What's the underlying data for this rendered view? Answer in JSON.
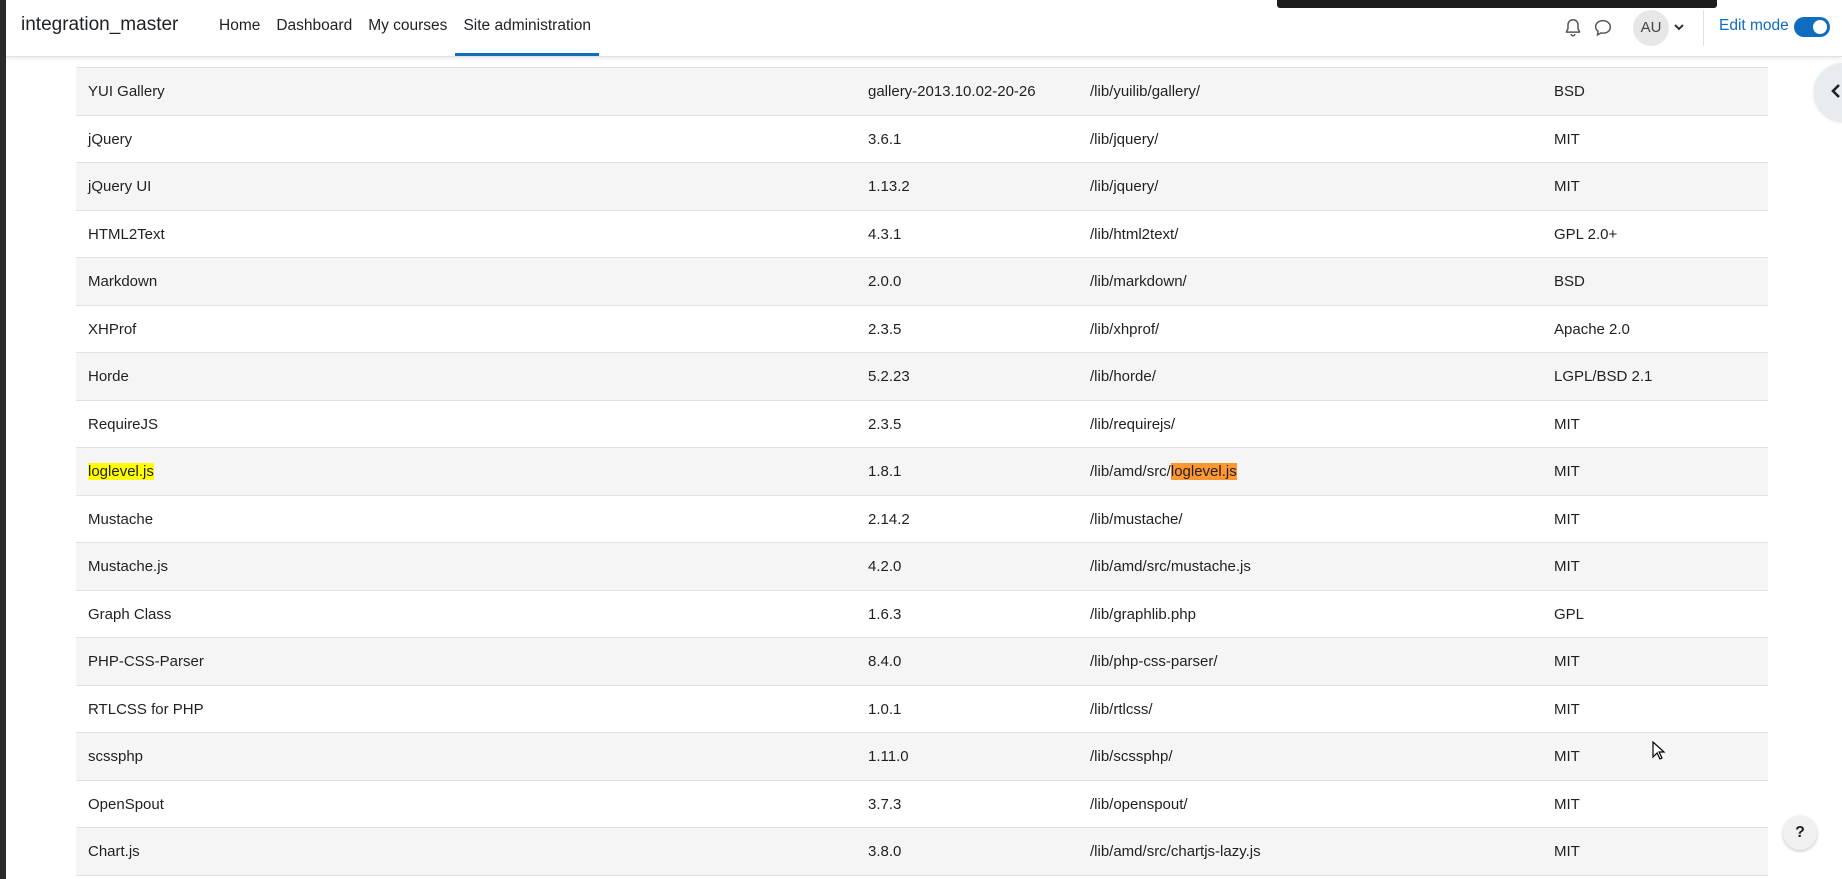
{
  "navbar": {
    "brand": "integration_master",
    "links": [
      {
        "label": "Home",
        "active": false
      },
      {
        "label": "Dashboard",
        "active": false
      },
      {
        "label": "My courses",
        "active": false
      },
      {
        "label": "Site administration",
        "active": true
      }
    ],
    "user_initials": "AU",
    "edit_mode_label": "Edit mode",
    "edit_mode_on": true,
    "accent_color": "#0f6cbf"
  },
  "table": {
    "rows": [
      {
        "name": "YUI Gallery",
        "version": "gallery-2013.10.02-20-26",
        "location": "/lib/yuilib/gallery/",
        "license": "BSD"
      },
      {
        "name": "jQuery",
        "version": "3.6.1",
        "location": "/lib/jquery/",
        "license": "MIT"
      },
      {
        "name": "jQuery UI",
        "version": "1.13.2",
        "location": "/lib/jquery/",
        "license": "MIT"
      },
      {
        "name": "HTML2Text",
        "version": "4.3.1",
        "location": "/lib/html2text/",
        "license": "GPL 2.0+"
      },
      {
        "name": "Markdown",
        "version": "2.0.0",
        "location": "/lib/markdown/",
        "license": "BSD"
      },
      {
        "name": "XHProf",
        "version": "2.3.5",
        "location": "/lib/xhprof/",
        "license": "Apache 2.0"
      },
      {
        "name": "Horde",
        "version": "5.2.23",
        "location": "/lib/horde/",
        "license": "LGPL/BSD 2.1"
      },
      {
        "name": "RequireJS",
        "version": "2.3.5",
        "location": "/lib/requirejs/",
        "license": "MIT"
      },
      {
        "name": "loglevel.js",
        "version": "1.8.1",
        "location_prefix": "/lib/amd/src/",
        "location_match": "loglevel.js",
        "license": "MIT"
      },
      {
        "name": "Mustache",
        "version": "2.14.2",
        "location": "/lib/mustache/",
        "license": "MIT"
      },
      {
        "name": "Mustache.js",
        "version": "4.2.0",
        "location": "/lib/amd/src/mustache.js",
        "license": "MIT"
      },
      {
        "name": "Graph Class",
        "version": "1.6.3",
        "location": "/lib/graphlib.php",
        "license": "GPL"
      },
      {
        "name": "PHP-CSS-Parser",
        "version": "8.4.0",
        "location": "/lib/php-css-parser/",
        "license": "MIT"
      },
      {
        "name": "RTLCSS for PHP",
        "version": "1.0.1",
        "location": "/lib/rtlcss/",
        "license": "MIT"
      },
      {
        "name": "scssphp",
        "version": "1.11.0",
        "location": "/lib/scssphp/",
        "license": "MIT"
      },
      {
        "name": "OpenSpout",
        "version": "3.7.3",
        "location": "/lib/openspout/",
        "license": "MIT"
      },
      {
        "name": "Chart.js",
        "version": "3.8.0",
        "location": "/lib/amd/src/chartjs-lazy.js",
        "license": "MIT"
      }
    ]
  },
  "help_button": "?",
  "icons": {
    "notifications": "bell-icon",
    "messages": "chat-icon",
    "user_menu": "chevron-down-icon",
    "drawer": "chevron-left-icon",
    "help": "question-icon"
  }
}
